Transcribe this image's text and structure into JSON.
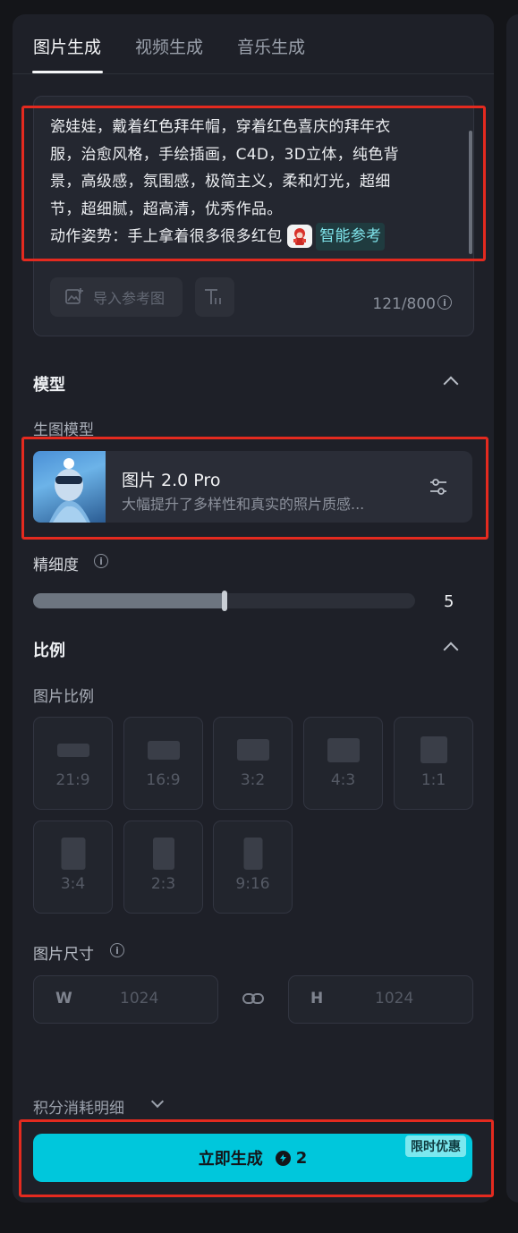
{
  "tabs": [
    {
      "label": "图片生成",
      "active": true
    },
    {
      "label": "视频生成",
      "active": false
    },
    {
      "label": "音乐生成",
      "active": false
    }
  ],
  "prompt": {
    "lines": [
      "瓷娃娃，戴着红色拜年帽，穿着红色喜庆的拜年衣",
      "服，治愈风格，手绘插画，C4D，3D立体，纯色背",
      "景，高级感，氛围感，极简主义，柔和灯光，超细",
      "节，超细腻，超高清，优秀作品。",
      "动作姿势：手上拿着很多很多红包"
    ],
    "smart_ref_label": "智能参考",
    "upload_label": "导入参考图",
    "counter": "121/800"
  },
  "model_section": {
    "title": "模型",
    "sub_label": "生图模型",
    "model_name": "图片 2.0 Pro",
    "model_desc": "大幅提升了多样性和真实的照片质感..."
  },
  "detail": {
    "label": "精细度",
    "value": "5",
    "fraction": 0.5
  },
  "ratio_section": {
    "title": "比例",
    "sub_label": "图片比例",
    "ratios": [
      "21:9",
      "16:9",
      "3:2",
      "4:3",
      "1:1",
      "3:4",
      "2:3",
      "9:16"
    ]
  },
  "size": {
    "label": "图片尺寸",
    "w_label": "W",
    "w_value": "1024",
    "h_label": "H",
    "h_value": "1024"
  },
  "cost_label": "积分消耗明细",
  "generate": {
    "label": "立即生成",
    "cost": "2",
    "promo": "限时优惠"
  },
  "colors": {
    "accent": "#00c7dc",
    "highlight": "#e42a1f"
  }
}
